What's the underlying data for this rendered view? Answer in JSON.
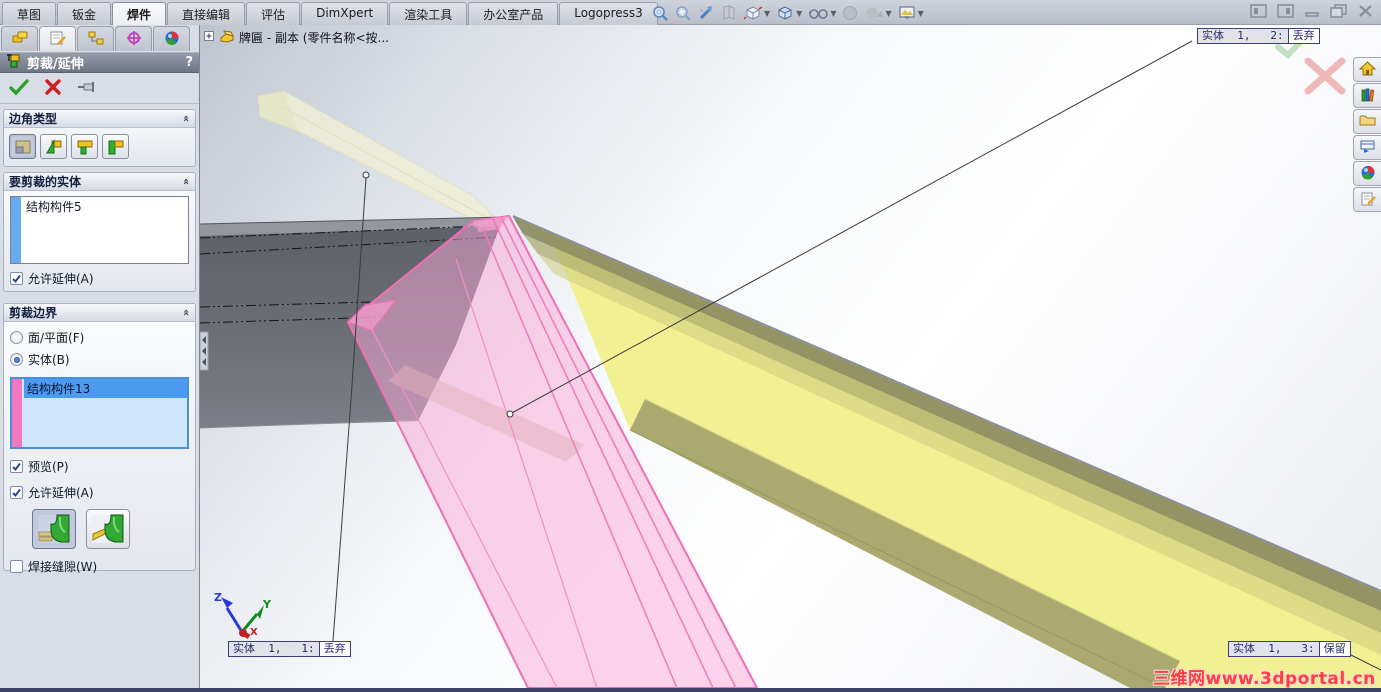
{
  "command_tabs": {
    "items": [
      {
        "label": "草图",
        "active": false
      },
      {
        "label": "钣金",
        "active": false
      },
      {
        "label": "焊件",
        "active": true
      },
      {
        "label": "直接编辑",
        "active": false
      },
      {
        "label": "评估",
        "active": false
      },
      {
        "label": "DimXpert",
        "active": false
      },
      {
        "label": "渲染工具",
        "active": false
      },
      {
        "label": "办公室产品",
        "active": false
      },
      {
        "label": "Logopress3",
        "active": false
      }
    ]
  },
  "heads_up": {
    "icons": [
      "zoom-to-fit",
      "zoom-to-area",
      "magnified-selection",
      "section-view",
      "view-orientation",
      "display-style",
      "hide-show-items",
      "shadows",
      "edit-appearance",
      "apply-scene"
    ]
  },
  "window_controls": [
    "pane-left",
    "pane-right",
    "minimize",
    "restore",
    "close"
  ],
  "feature_tree": {
    "root": "牌匾 - 副本  (零件名称<按..."
  },
  "pm": {
    "tabs": [
      "feature-manager",
      "property-manager",
      "configuration-manager",
      "dimxpert-manager",
      "display-manager"
    ],
    "title": "剪裁/延伸",
    "help": "?",
    "corner_type": {
      "header": "边角类型",
      "buttons": [
        "end-trim",
        "end-miter",
        "end-butt1",
        "end-butt2"
      ],
      "selected": "end-trim"
    },
    "bodies": {
      "header": "要剪裁的实体",
      "items": [
        "结构构件5"
      ],
      "allow_extend_label": "允许延伸(A)",
      "allow_extend_checked": true
    },
    "boundary": {
      "header": "剪裁边界",
      "radio_face_label": "面/平面(F)",
      "radio_body_label": "实体(B)",
      "selected_radio": "实体(B)",
      "items": [
        "结构构件13"
      ],
      "selected_item": "结构构件13",
      "preview_label": "预览(P)",
      "preview_checked": true,
      "allow_extend_label": "允许延伸(A)",
      "allow_extend_checked": true,
      "weld_gap_label": "焊接缝隙(W)",
      "weld_gap_checked": false
    }
  },
  "viewport": {
    "callouts": [
      {
        "label": "实体  1,   2:",
        "action": "丢弃"
      },
      {
        "label": "实体  1,   1:",
        "action": "丢弃"
      },
      {
        "label": "实体  1,   3:",
        "action": "保留"
      }
    ],
    "triad": {
      "x": "X",
      "y": "Y",
      "z": "Z"
    },
    "watermark": "三维网www.3dportal.cn"
  },
  "task_pane": {
    "tabs": [
      "home",
      "design-library",
      "file-explorer",
      "view-palette",
      "appearances",
      "custom-properties"
    ]
  },
  "colors": {
    "selection_pink": "#ef6eb4",
    "beam_yellow": "#f1f194",
    "beam_gray": "#686b71",
    "highlight_blue": "#4d9bf0",
    "title_bar": "#7d8390"
  }
}
